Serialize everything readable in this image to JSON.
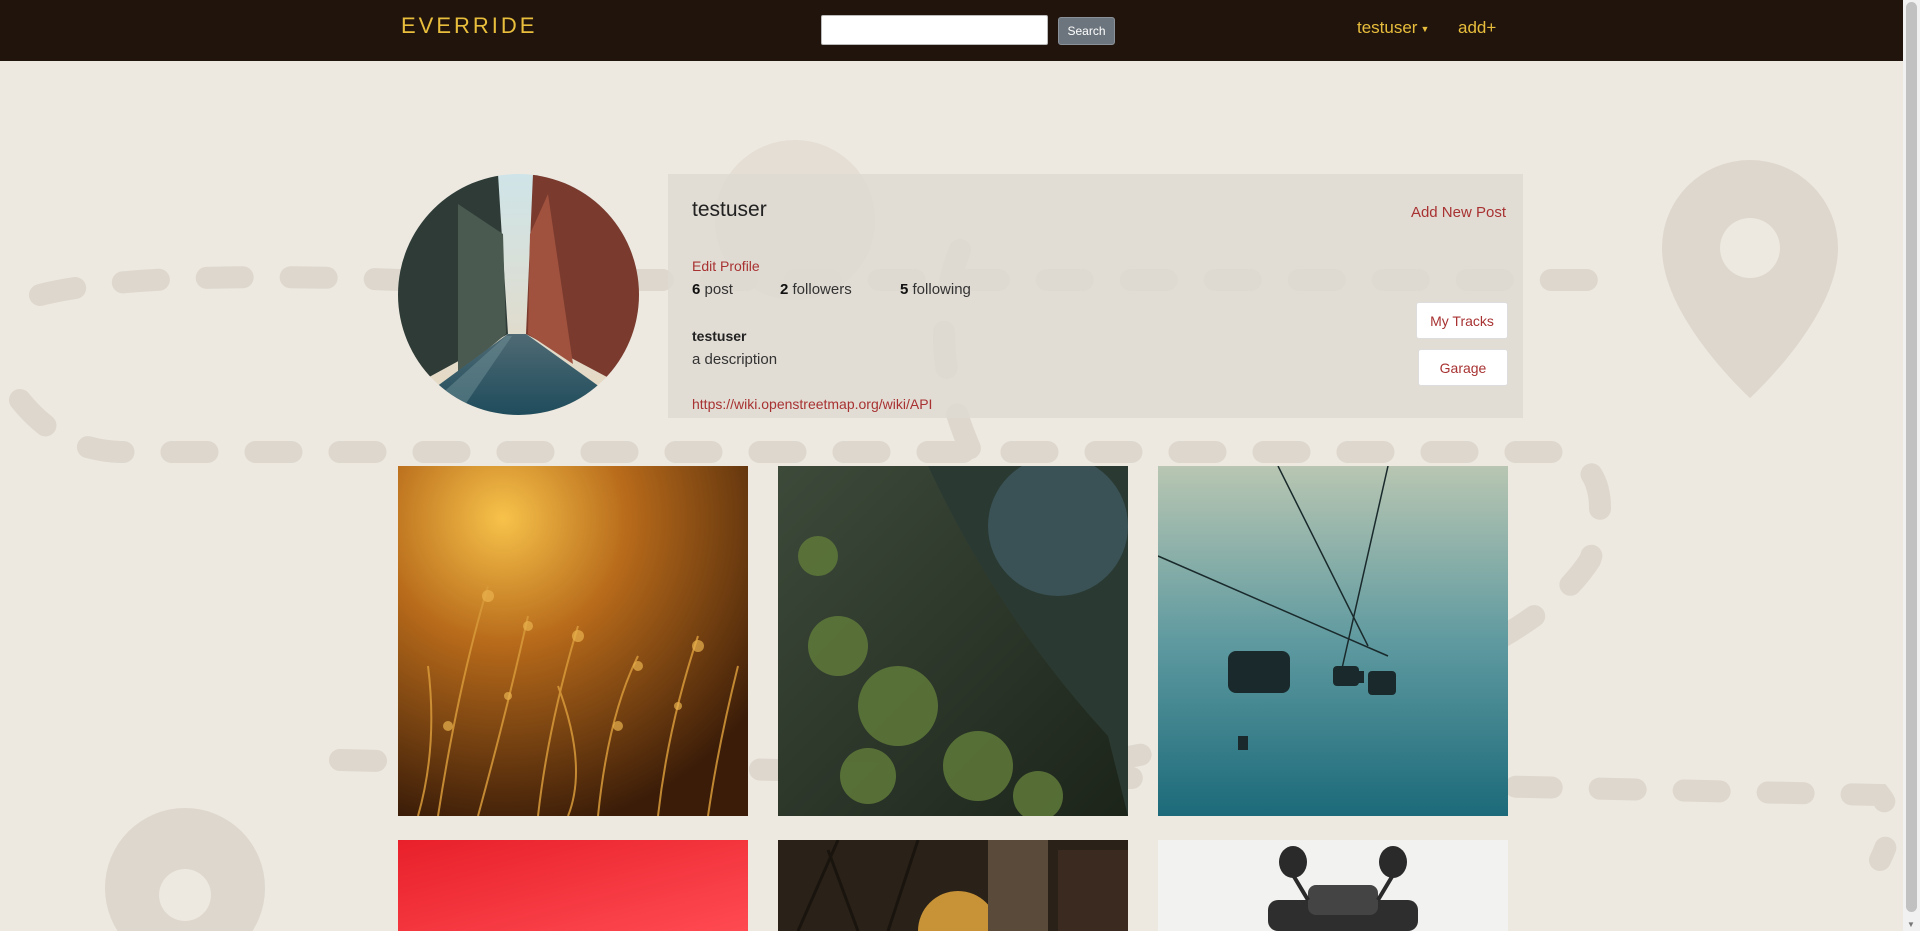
{
  "navbar": {
    "brand": "EVERRIDE",
    "search_placeholder": "",
    "search_button": "Search",
    "user_menu": "testuser",
    "add_link": "add+"
  },
  "profile": {
    "username": "testuser",
    "add_new_post": "Add New Post",
    "edit_profile": "Edit Profile",
    "stats": {
      "posts_count": "6",
      "posts_label": "post",
      "followers_count": "2",
      "followers_label": "followers",
      "following_count": "5",
      "following_label": "following"
    },
    "display_name": "testuser",
    "bio": "a description",
    "link": "https://wiki.openstreetmap.org/wiki/API",
    "my_tracks_button": "My Tracks",
    "garage_button": "Garage"
  },
  "posts": [
    {
      "subject": "golden backlit grass"
    },
    {
      "subject": "mossy tree trunk"
    },
    {
      "subject": "ski chairlift in fog"
    },
    {
      "subject": "red background"
    },
    {
      "subject": "city street at sunset"
    },
    {
      "subject": "motorcycle"
    }
  ],
  "colors": {
    "navbar_bg": "#21140c",
    "brand_accent": "#e8be3c",
    "link_red": "#a83232",
    "page_bg": "#ede8e0"
  }
}
